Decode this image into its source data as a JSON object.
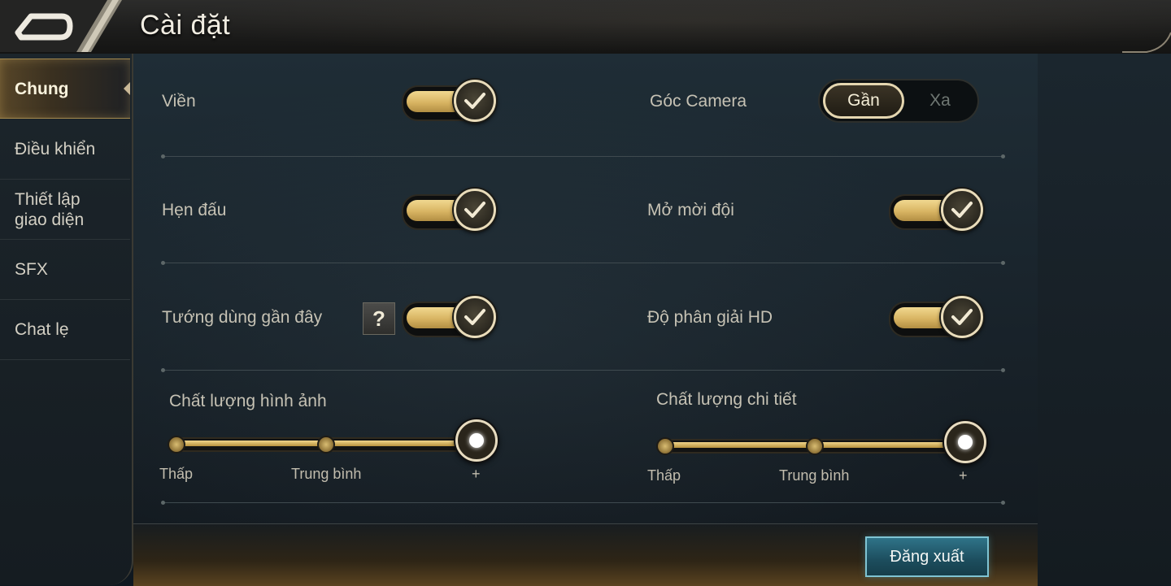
{
  "header": {
    "title": "Cài đặt",
    "back_icon": "back-arrow-icon"
  },
  "sidebar": {
    "items": [
      {
        "label": "Chung",
        "active": true
      },
      {
        "label": "Điều khiển",
        "active": false
      },
      {
        "label": "Thiết lập giao diện",
        "active": false
      },
      {
        "label": "SFX",
        "active": false
      },
      {
        "label": "Chat lẹ",
        "active": false
      }
    ]
  },
  "settings": {
    "vien": {
      "label": "Viền",
      "on": true
    },
    "goc_camera": {
      "label": "Góc Camera",
      "options": [
        "Gần",
        "Xa"
      ],
      "selected": "Gần"
    },
    "hen_dau": {
      "label": "Hẹn đấu",
      "on": true
    },
    "mo_moi_doi": {
      "label": "Mở mời đội",
      "on": true
    },
    "tuong_dung": {
      "label": "Tướng dùng gần đây",
      "help": "?",
      "on": true
    },
    "do_phan_giai": {
      "label": "Độ phân giải HD",
      "on": true
    },
    "chat_luong_hinh_anh": {
      "label": "Chất lượng hình ảnh",
      "ticks": [
        "Thấp",
        "Trung bình",
        "+"
      ],
      "level": 1.0
    },
    "chat_luong_chi_tiet": {
      "label": "Chất lượng chi tiết",
      "ticks": [
        "Thấp",
        "Trung bình",
        "+"
      ],
      "level": 1.0
    }
  },
  "footer": {
    "logout_label": "Đăng xuất"
  },
  "colors": {
    "accent_gold": "#d8b462",
    "logout_teal": "#2f7388"
  }
}
